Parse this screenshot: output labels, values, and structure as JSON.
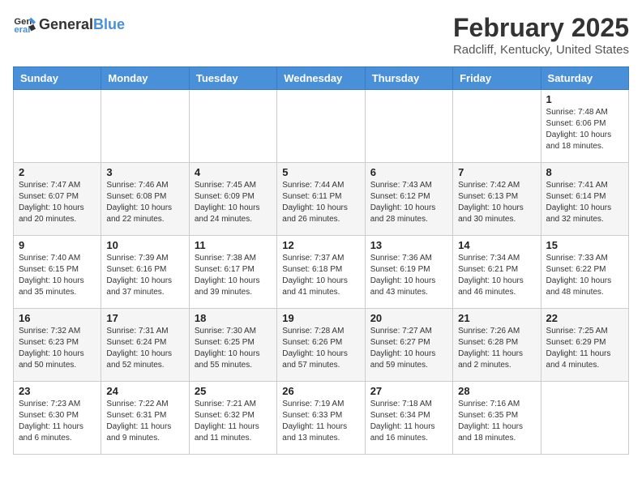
{
  "header": {
    "logo_general": "General",
    "logo_blue": "Blue",
    "main_title": "February 2025",
    "subtitle": "Radcliff, Kentucky, United States"
  },
  "weekdays": [
    "Sunday",
    "Monday",
    "Tuesday",
    "Wednesday",
    "Thursday",
    "Friday",
    "Saturday"
  ],
  "weeks": [
    [
      {
        "day": "",
        "info": ""
      },
      {
        "day": "",
        "info": ""
      },
      {
        "day": "",
        "info": ""
      },
      {
        "day": "",
        "info": ""
      },
      {
        "day": "",
        "info": ""
      },
      {
        "day": "",
        "info": ""
      },
      {
        "day": "1",
        "info": "Sunrise: 7:48 AM\nSunset: 6:06 PM\nDaylight: 10 hours and 18 minutes."
      }
    ],
    [
      {
        "day": "2",
        "info": "Sunrise: 7:47 AM\nSunset: 6:07 PM\nDaylight: 10 hours and 20 minutes."
      },
      {
        "day": "3",
        "info": "Sunrise: 7:46 AM\nSunset: 6:08 PM\nDaylight: 10 hours and 22 minutes."
      },
      {
        "day": "4",
        "info": "Sunrise: 7:45 AM\nSunset: 6:09 PM\nDaylight: 10 hours and 24 minutes."
      },
      {
        "day": "5",
        "info": "Sunrise: 7:44 AM\nSunset: 6:11 PM\nDaylight: 10 hours and 26 minutes."
      },
      {
        "day": "6",
        "info": "Sunrise: 7:43 AM\nSunset: 6:12 PM\nDaylight: 10 hours and 28 minutes."
      },
      {
        "day": "7",
        "info": "Sunrise: 7:42 AM\nSunset: 6:13 PM\nDaylight: 10 hours and 30 minutes."
      },
      {
        "day": "8",
        "info": "Sunrise: 7:41 AM\nSunset: 6:14 PM\nDaylight: 10 hours and 32 minutes."
      }
    ],
    [
      {
        "day": "9",
        "info": "Sunrise: 7:40 AM\nSunset: 6:15 PM\nDaylight: 10 hours and 35 minutes."
      },
      {
        "day": "10",
        "info": "Sunrise: 7:39 AM\nSunset: 6:16 PM\nDaylight: 10 hours and 37 minutes."
      },
      {
        "day": "11",
        "info": "Sunrise: 7:38 AM\nSunset: 6:17 PM\nDaylight: 10 hours and 39 minutes."
      },
      {
        "day": "12",
        "info": "Sunrise: 7:37 AM\nSunset: 6:18 PM\nDaylight: 10 hours and 41 minutes."
      },
      {
        "day": "13",
        "info": "Sunrise: 7:36 AM\nSunset: 6:19 PM\nDaylight: 10 hours and 43 minutes."
      },
      {
        "day": "14",
        "info": "Sunrise: 7:34 AM\nSunset: 6:21 PM\nDaylight: 10 hours and 46 minutes."
      },
      {
        "day": "15",
        "info": "Sunrise: 7:33 AM\nSunset: 6:22 PM\nDaylight: 10 hours and 48 minutes."
      }
    ],
    [
      {
        "day": "16",
        "info": "Sunrise: 7:32 AM\nSunset: 6:23 PM\nDaylight: 10 hours and 50 minutes."
      },
      {
        "day": "17",
        "info": "Sunrise: 7:31 AM\nSunset: 6:24 PM\nDaylight: 10 hours and 52 minutes."
      },
      {
        "day": "18",
        "info": "Sunrise: 7:30 AM\nSunset: 6:25 PM\nDaylight: 10 hours and 55 minutes."
      },
      {
        "day": "19",
        "info": "Sunrise: 7:28 AM\nSunset: 6:26 PM\nDaylight: 10 hours and 57 minutes."
      },
      {
        "day": "20",
        "info": "Sunrise: 7:27 AM\nSunset: 6:27 PM\nDaylight: 10 hours and 59 minutes."
      },
      {
        "day": "21",
        "info": "Sunrise: 7:26 AM\nSunset: 6:28 PM\nDaylight: 11 hours and 2 minutes."
      },
      {
        "day": "22",
        "info": "Sunrise: 7:25 AM\nSunset: 6:29 PM\nDaylight: 11 hours and 4 minutes."
      }
    ],
    [
      {
        "day": "23",
        "info": "Sunrise: 7:23 AM\nSunset: 6:30 PM\nDaylight: 11 hours and 6 minutes."
      },
      {
        "day": "24",
        "info": "Sunrise: 7:22 AM\nSunset: 6:31 PM\nDaylight: 11 hours and 9 minutes."
      },
      {
        "day": "25",
        "info": "Sunrise: 7:21 AM\nSunset: 6:32 PM\nDaylight: 11 hours and 11 minutes."
      },
      {
        "day": "26",
        "info": "Sunrise: 7:19 AM\nSunset: 6:33 PM\nDaylight: 11 hours and 13 minutes."
      },
      {
        "day": "27",
        "info": "Sunrise: 7:18 AM\nSunset: 6:34 PM\nDaylight: 11 hours and 16 minutes."
      },
      {
        "day": "28",
        "info": "Sunrise: 7:16 AM\nSunset: 6:35 PM\nDaylight: 11 hours and 18 minutes."
      },
      {
        "day": "",
        "info": ""
      }
    ]
  ]
}
